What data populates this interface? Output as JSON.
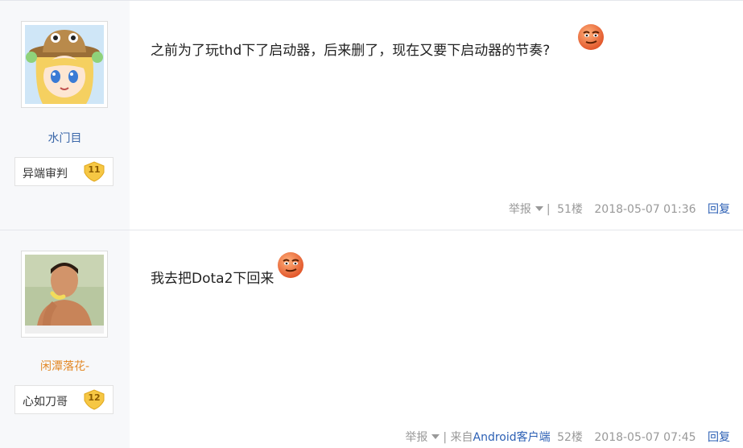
{
  "posts": [
    {
      "username": "水门目",
      "rank_title": "异端审判",
      "rank_level": "11",
      "text": "之前为了玩thd下了启动器，后来删了，现在又要下启动器的节奏?",
      "report_label": "举报",
      "separator": "|",
      "source_prefix": "",
      "source_client": "",
      "floor": "51楼",
      "time": "2018-05-07 01:36",
      "reply_label": "回复"
    },
    {
      "username": "闲潭落花-",
      "rank_title": "心如刀哥",
      "rank_level": "12",
      "text": "我去把Dota2下回来",
      "report_label": "举报",
      "separator": "|",
      "source_prefix": "来自",
      "source_client": "Android客户端",
      "floor": "52楼",
      "time": "2018-05-07 07:45",
      "reply_label": "回复"
    }
  ],
  "icons": {
    "emoji": "smirk-face-emoji",
    "badge": "level-badge-icon",
    "caret": "caret-down-icon"
  },
  "colors": {
    "username_1": "#3a66a8",
    "username_2": "#e38a2a",
    "link": "#2b5fb4",
    "meta": "#999999",
    "sidebar_bg": "#f7f8fa"
  }
}
